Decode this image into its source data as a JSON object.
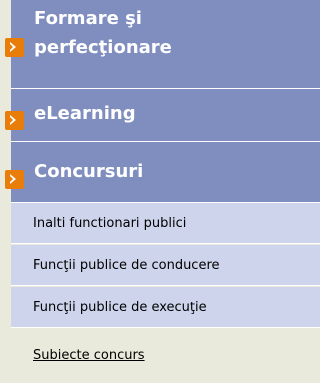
{
  "menu": {
    "main_items": [
      {
        "label_line1": "Formare şi",
        "label_line2": "perfecţionare"
      },
      {
        "label": "eLearning"
      },
      {
        "label": "Concursuri"
      }
    ],
    "sub_items": [
      {
        "label": "Inalti functionari publici"
      },
      {
        "label": "Funcţii publice de conducere"
      },
      {
        "label": "Funcţii publice de execuţie"
      },
      {
        "label": "Subiecte concurs"
      }
    ]
  },
  "colors": {
    "main_bg": "#7f8ebf",
    "sub_bg": "#cdd4ec",
    "arrow": "#e87d0a",
    "page_bg": "#e9e9dc"
  }
}
